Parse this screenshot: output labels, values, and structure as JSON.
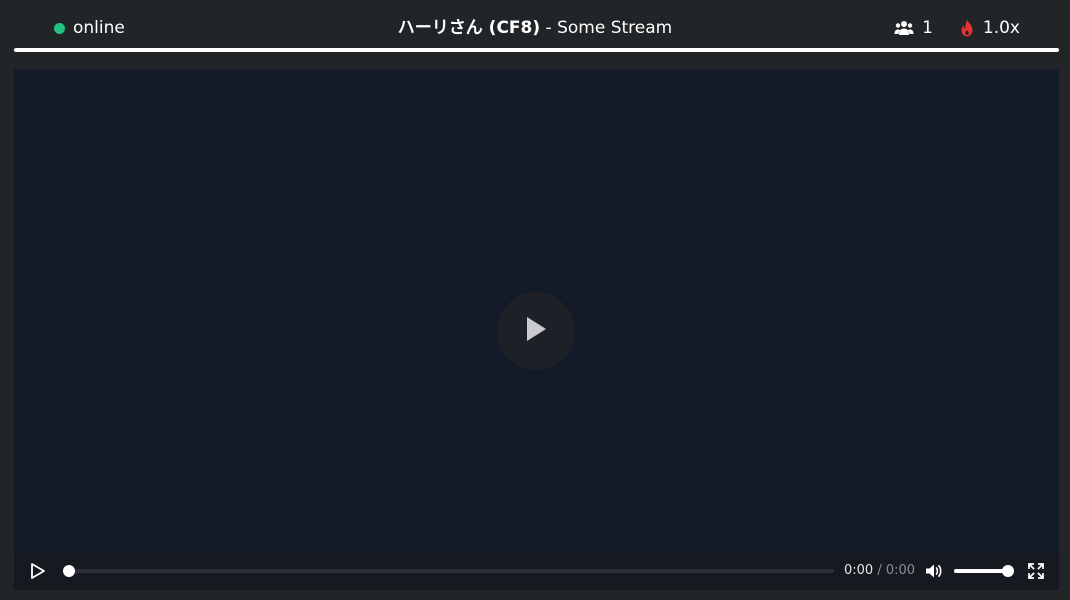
{
  "header": {
    "status_label": "online",
    "status_color": "#22c37f",
    "title_name": "ハーリさん (CF8)",
    "title_separator": " - ",
    "title_stream": "Some Stream",
    "viewers_icon": "users-icon",
    "viewers_count": "1",
    "hype_icon": "fire-icon",
    "hype_color": "#e5322d",
    "hype_multiplier": "1.0x"
  },
  "player": {
    "big_play_icon": "play-icon",
    "current_time": "0:00",
    "time_separator": " / ",
    "duration": "0:00",
    "progress": 0.0,
    "volume": 1.0,
    "mute_icon": "volume-icon",
    "fullscreen_icon": "fullscreen-icon"
  }
}
